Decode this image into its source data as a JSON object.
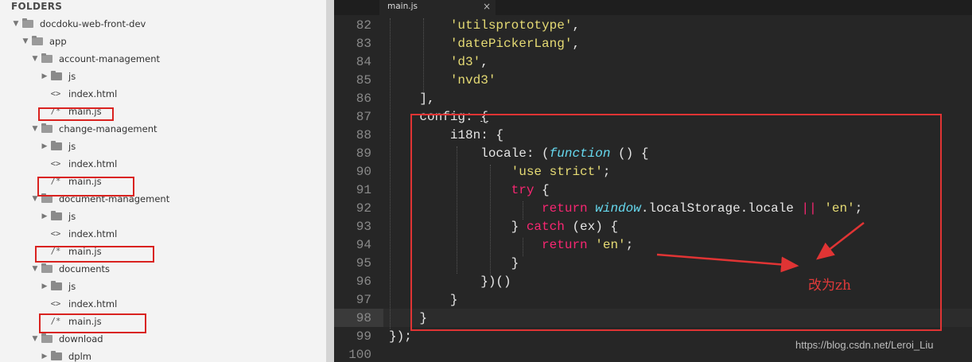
{
  "sidebar": {
    "header": "FOLDERS",
    "tree": [
      {
        "label": "docdoku-web-front-dev",
        "type": "folder",
        "expanded": true
      },
      {
        "label": "app",
        "type": "folder",
        "expanded": true
      },
      {
        "label": "account-management",
        "type": "folder",
        "expanded": true
      },
      {
        "label": "js",
        "type": "folder",
        "expanded": false
      },
      {
        "label": "index.html",
        "type": "file",
        "icon": "<>"
      },
      {
        "label": "main.js",
        "type": "file",
        "icon": "/*"
      },
      {
        "label": "change-management",
        "type": "folder",
        "expanded": true
      },
      {
        "label": "js",
        "type": "folder",
        "expanded": false
      },
      {
        "label": "index.html",
        "type": "file",
        "icon": "<>"
      },
      {
        "label": "main.js",
        "type": "file",
        "icon": "/*"
      },
      {
        "label": "document-management",
        "type": "folder",
        "expanded": true
      },
      {
        "label": "js",
        "type": "folder",
        "expanded": false
      },
      {
        "label": "index.html",
        "type": "file",
        "icon": "<>"
      },
      {
        "label": "main.js",
        "type": "file",
        "icon": "/*"
      },
      {
        "label": "documents",
        "type": "folder",
        "expanded": true
      },
      {
        "label": "js",
        "type": "folder",
        "expanded": false
      },
      {
        "label": "index.html",
        "type": "file",
        "icon": "<>"
      },
      {
        "label": "main.js",
        "type": "file",
        "icon": "/*"
      },
      {
        "label": "download",
        "type": "folder",
        "expanded": true
      },
      {
        "label": "dplm",
        "type": "folder",
        "expanded": false
      }
    ]
  },
  "editor": {
    "tab": {
      "label": "main.js",
      "close": "×"
    },
    "line_numbers": [
      "82",
      "83",
      "84",
      "85",
      "86",
      "87",
      "88",
      "89",
      "90",
      "91",
      "92",
      "93",
      "94",
      "95",
      "96",
      "97",
      "98",
      "99",
      "100"
    ],
    "annotation": "改为zh",
    "watermark": "https://blog.csdn.net/Leroi_Liu"
  },
  "colors": {
    "highlight_box": "#e03434",
    "string": "#e6db74",
    "keyword": "#f92672",
    "function": "#66d9ef",
    "editor_bg": "#262626"
  }
}
